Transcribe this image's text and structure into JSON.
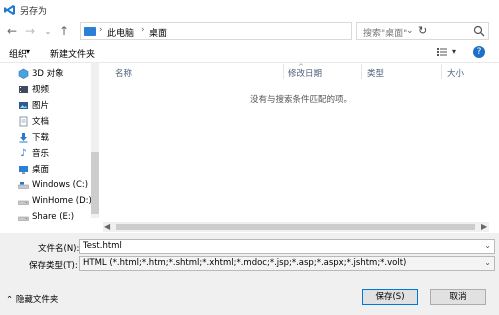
{
  "window": {
    "title": "另存为"
  },
  "address": {
    "crumbs": [
      "此电脑",
      "桌面"
    ],
    "separator": "›"
  },
  "search": {
    "placeholder": "搜索\"桌面\""
  },
  "toolbar": {
    "organize_label": "组织",
    "new_folder_label": "新建文件夹"
  },
  "nav": {
    "items": [
      {
        "label": "3D 对象",
        "icon": "3d-objects-icon"
      },
      {
        "label": "视频",
        "icon": "video-icon"
      },
      {
        "label": "图片",
        "icon": "pictures-icon"
      },
      {
        "label": "文档",
        "icon": "documents-icon"
      },
      {
        "label": "下载",
        "icon": "download-icon"
      },
      {
        "label": "音乐",
        "icon": "music-icon"
      },
      {
        "label": "桌面",
        "icon": "desktop-icon"
      },
      {
        "label": "Windows (C:)",
        "icon": "drive-icon"
      },
      {
        "label": "WinHome (D:)",
        "icon": "drive-icon"
      },
      {
        "label": "Share (E:)",
        "icon": "drive-icon"
      }
    ]
  },
  "list": {
    "columns": [
      "名称",
      "修改日期",
      "类型",
      "大小"
    ],
    "empty_message": "没有与搜索条件匹配的项。"
  },
  "form": {
    "filename_label": "文件名(N):",
    "filename_value": "Test.html",
    "filetype_label": "保存类型(T):",
    "filetype_value": "HTML (*.html;*.htm;*.shtml;*.xhtml;*.mdoc;*.jsp;*.asp;*.aspx;*.jshtm;*.volt)"
  },
  "footer": {
    "hide_folders_label": "隐藏文件夹",
    "save_label": "保存(S)",
    "cancel_label": "取消"
  },
  "colors": {
    "accent": "#1e6fc6",
    "header_text": "#4c607a"
  }
}
